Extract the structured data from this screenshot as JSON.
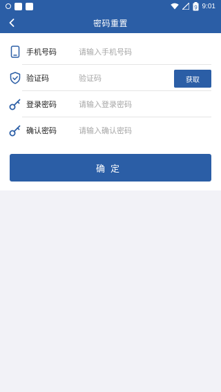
{
  "status_bar": {
    "time": "9:01",
    "battery_level": "9"
  },
  "header": {
    "title": "密码重置",
    "back_icon": "chevron-left-icon"
  },
  "form": {
    "rows": [
      {
        "icon": "phone-icon",
        "label": "手机号码",
        "placeholder": "请输入手机号码",
        "value": ""
      },
      {
        "icon": "shield-check-icon",
        "label": "验证码",
        "placeholder": "验证码",
        "value": ""
      },
      {
        "icon": "key-icon",
        "label": "登录密码",
        "placeholder": "请输入登录密码",
        "value": ""
      },
      {
        "icon": "key-icon",
        "label": "确认密码",
        "placeholder": "请输入确认密码",
        "value": ""
      }
    ],
    "get_code_label": "获取"
  },
  "confirm_label": "确定",
  "colors": {
    "primary": "#2b5ea6",
    "background": "#f2f2f7",
    "placeholder": "#a6a6a6"
  }
}
